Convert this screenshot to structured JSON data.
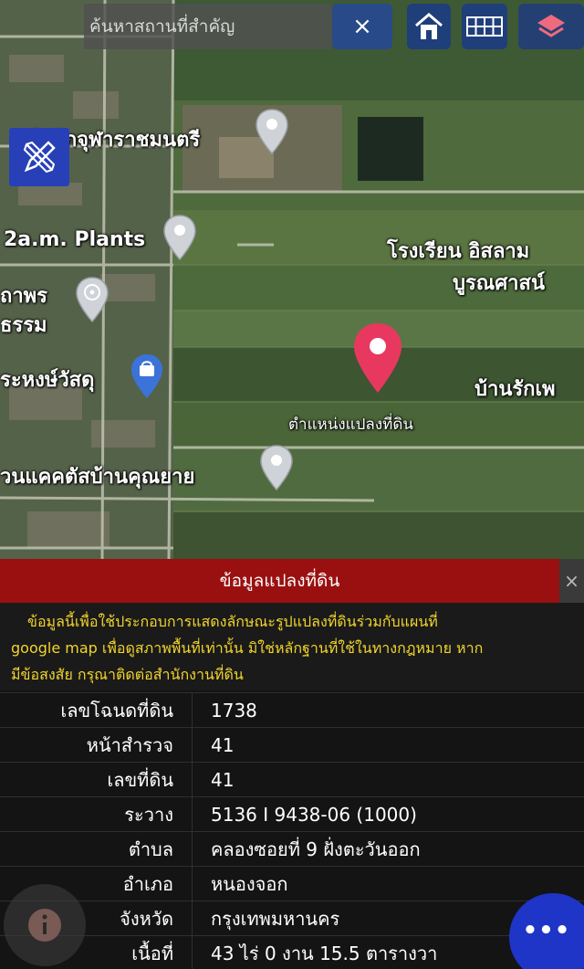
{
  "search": {
    "placeholder": "ค้นหาสถานที่สำคัญ",
    "clear_label": "×"
  },
  "map": {
    "labels": {
      "chula": "สำนักจุฬาราชมนตรี",
      "plants": "2a.m. Plants",
      "school_1": "โรงเรียน อิสลาม",
      "school_2": "บูรณศาสน์",
      "left_1a": "ถาพร",
      "left_1b": "ธรรม",
      "shop": "ระหงษ์วัสดุ",
      "ban_rak": "บ้านรักเพ",
      "parcel": "ตำแหน่งแปลงที่ดิน",
      "cactus": "วนแคคตัสบ้านคุณยาย"
    },
    "pin_color": "#e8385f"
  },
  "panel": {
    "title": "ข้อมูลแปลงที่ดิน",
    "close_label": "×",
    "disclaimer": [
      "ข้อมูลนี้เพื่อใช้ประกอบการแสดงลักษณะรูปแปลงที่ดินร่วมกับแผนที่",
      "google map เพื่อดูสภาพพื้นที่เท่านั้น มิใช่หลักฐานที่ใช้ในทางกฎหมาย หาก",
      "มีข้อสงสัย กรุณาติดต่อสำนักงานที่ดิน"
    ],
    "rows": [
      {
        "label": "เลขโฉนดที่ดิน",
        "value": "1738"
      },
      {
        "label": "หน้าสำรวจ",
        "value": "41"
      },
      {
        "label": "เลขที่ดิน",
        "value": "41"
      },
      {
        "label": "ระวาง",
        "value": "5136 I 9438-06 (1000)"
      },
      {
        "label": "ตำบล",
        "value": "คลองซอยที่ 9 ฝั่งตะวันออก"
      },
      {
        "label": "อำเภอ",
        "value": "หนองจอก"
      },
      {
        "label": "จังหวัด",
        "value": "กรุงเทพมหานคร"
      },
      {
        "label": "เนื้อที่",
        "value": "43 ไร่ 0 งาน 15.5 ตารางวา"
      }
    ]
  },
  "fab": {
    "more_label": "•••"
  }
}
